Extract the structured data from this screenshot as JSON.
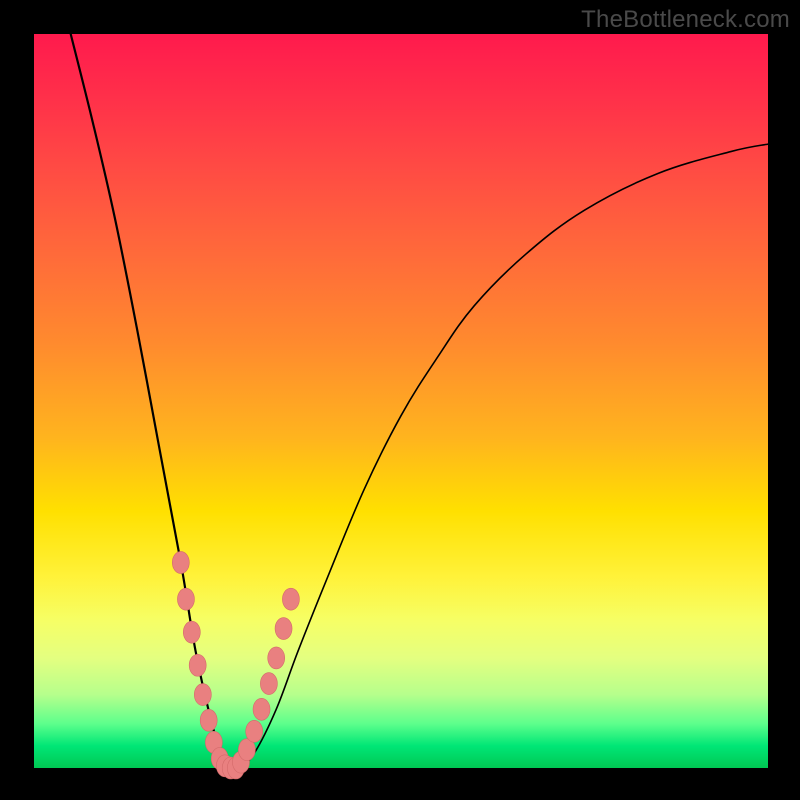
{
  "watermark": "TheBottleneck.com",
  "colors": {
    "frame": "#000000",
    "curve": "#000000",
    "marker_fill": "#e98080",
    "marker_stroke": "#d46a6a",
    "gradient_top": "#ff1a4d",
    "gradient_mid": "#ffe000",
    "gradient_bottom": "#00c853"
  },
  "chart_data": {
    "type": "line",
    "title": "",
    "xlabel": "",
    "ylabel": "",
    "xlim": [
      0,
      100
    ],
    "ylim": [
      0,
      100
    ],
    "grid": false,
    "legend": false,
    "series": [
      {
        "name": "bottleneck-curve",
        "x": [
          5,
          8,
          11,
          14,
          17,
          20,
          22,
          24,
          25.5,
          27,
          28,
          30,
          33,
          36,
          40,
          45,
          50,
          55,
          60,
          67,
          75,
          85,
          95,
          100
        ],
        "y": [
          100,
          88,
          75,
          60,
          44,
          28,
          16,
          7,
          2,
          0,
          0,
          2,
          8,
          16,
          26,
          38,
          48,
          56,
          63,
          70,
          76,
          81,
          84,
          85
        ]
      }
    ],
    "markers": {
      "name": "bottleneck-markers",
      "x": [
        20.0,
        20.7,
        21.5,
        22.3,
        23.0,
        23.8,
        24.5,
        25.3,
        26.0,
        26.8,
        27.5,
        28.2,
        29.0,
        30.0,
        31.0,
        32.0,
        33.0,
        34.0,
        35.0
      ],
      "y": [
        28.0,
        23.0,
        18.5,
        14.0,
        10.0,
        6.5,
        3.5,
        1.3,
        0.3,
        0.0,
        0.0,
        0.8,
        2.5,
        5.0,
        8.0,
        11.5,
        15.0,
        19.0,
        23.0
      ]
    },
    "minimum_x": 27,
    "annotations": []
  }
}
